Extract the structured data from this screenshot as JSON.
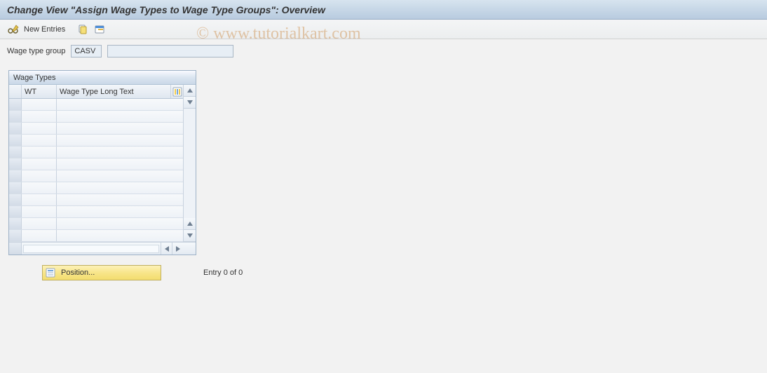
{
  "title": "Change View \"Assign Wage Types to Wage Type Groups\": Overview",
  "toolbar": {
    "new_entries_label": "New Entries"
  },
  "form": {
    "group_label": "Wage type group",
    "group_code": "CASV",
    "group_desc": ""
  },
  "panel": {
    "title": "Wage Types",
    "columns": {
      "wt": "WT",
      "long_text": "Wage Type Long Text"
    },
    "rows": [
      {
        "wt": "",
        "text": ""
      },
      {
        "wt": "",
        "text": ""
      },
      {
        "wt": "",
        "text": ""
      },
      {
        "wt": "",
        "text": ""
      },
      {
        "wt": "",
        "text": ""
      },
      {
        "wt": "",
        "text": ""
      },
      {
        "wt": "",
        "text": ""
      },
      {
        "wt": "",
        "text": ""
      },
      {
        "wt": "",
        "text": ""
      },
      {
        "wt": "",
        "text": ""
      },
      {
        "wt": "",
        "text": ""
      },
      {
        "wt": "",
        "text": ""
      }
    ]
  },
  "footer": {
    "position_label": "Position...",
    "entry_text": "Entry 0 of 0"
  },
  "watermark": "© www.tutorialkart.com"
}
